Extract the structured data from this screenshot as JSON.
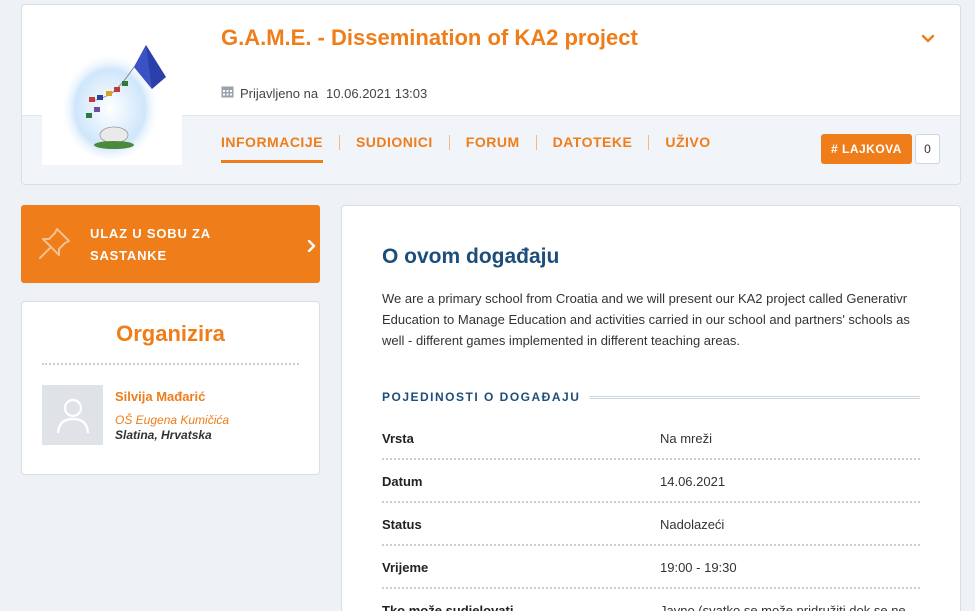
{
  "event": {
    "title": "G.A.M.E. - Dissemination of KA2 project",
    "registered_label": "Prijavljeno na",
    "registered_date": "10.06.2021 13:03"
  },
  "tabs": [
    {
      "label": "INFORMACIJE",
      "active": true
    },
    {
      "label": "SUDIONICI",
      "active": false
    },
    {
      "label": "FORUM",
      "active": false
    },
    {
      "label": "DATOTEKE",
      "active": false
    },
    {
      "label": "UŽIVO",
      "active": false
    }
  ],
  "likes": {
    "label": "# LAJKOVA",
    "count": "0"
  },
  "meeting_button": {
    "label": "ULAZ U SOBU ZA SASTANKE"
  },
  "organizer": {
    "heading": "Organizira",
    "name": "Silvija Mađarić",
    "school": "OŠ Eugena Kumičića",
    "location": "Slatina, Hrvatska"
  },
  "about": {
    "heading": "O ovom događaju",
    "description": "We are a primary school from Croatia and we will present our KA2 project called Generativr Education to Manage Education and activities carried in our school and partners' schools as well - different games implemented in different teaching areas.",
    "details_heading": "POJEDINOSTI O DOGAĐAJU",
    "details": [
      {
        "key": "Vrsta",
        "value": "Na mreži"
      },
      {
        "key": "Datum",
        "value": "14.06.2021"
      },
      {
        "key": "Status",
        "value": "Nadolazeći"
      },
      {
        "key": "Vrijeme",
        "value": "19:00 - 19:30"
      },
      {
        "key": "Tko može sudjelovati",
        "value": "Javno (svatko se može pridružiti dok se ne"
      }
    ]
  },
  "colors": {
    "accent": "#ee7d1a",
    "heading_blue": "#1d4e79",
    "background": "#eef2f6"
  },
  "icons": {
    "collapse": "chevron-down-icon",
    "calendar": "calendar-icon",
    "pin": "pin-icon",
    "enter": "chevron-right-icon",
    "avatar": "user-icon"
  }
}
